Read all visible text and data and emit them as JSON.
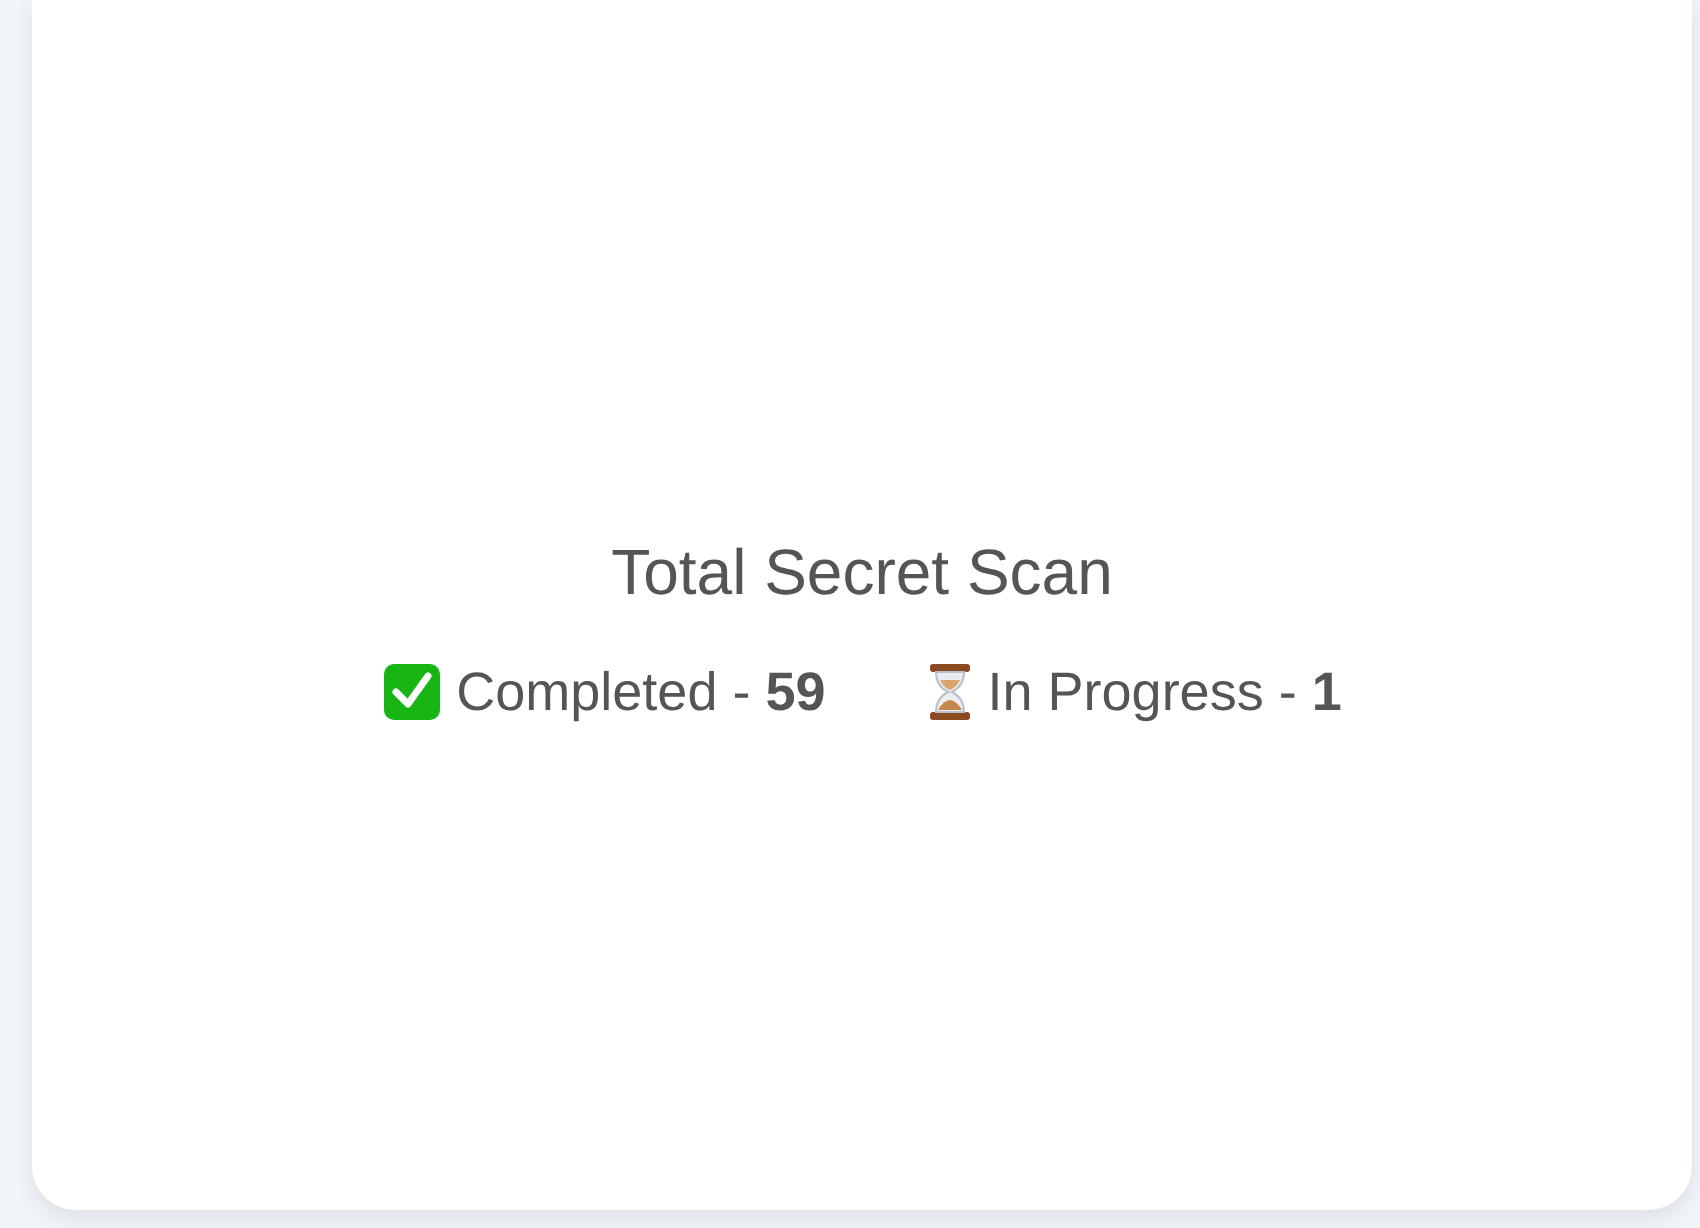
{
  "card": {
    "title": "Total Secret Scan",
    "statuses": [
      {
        "kind": "completed",
        "text": "Completed - **59**"
      },
      {
        "kind": "in_progress",
        "text": "In Progress - **1**"
      }
    ]
  }
}
